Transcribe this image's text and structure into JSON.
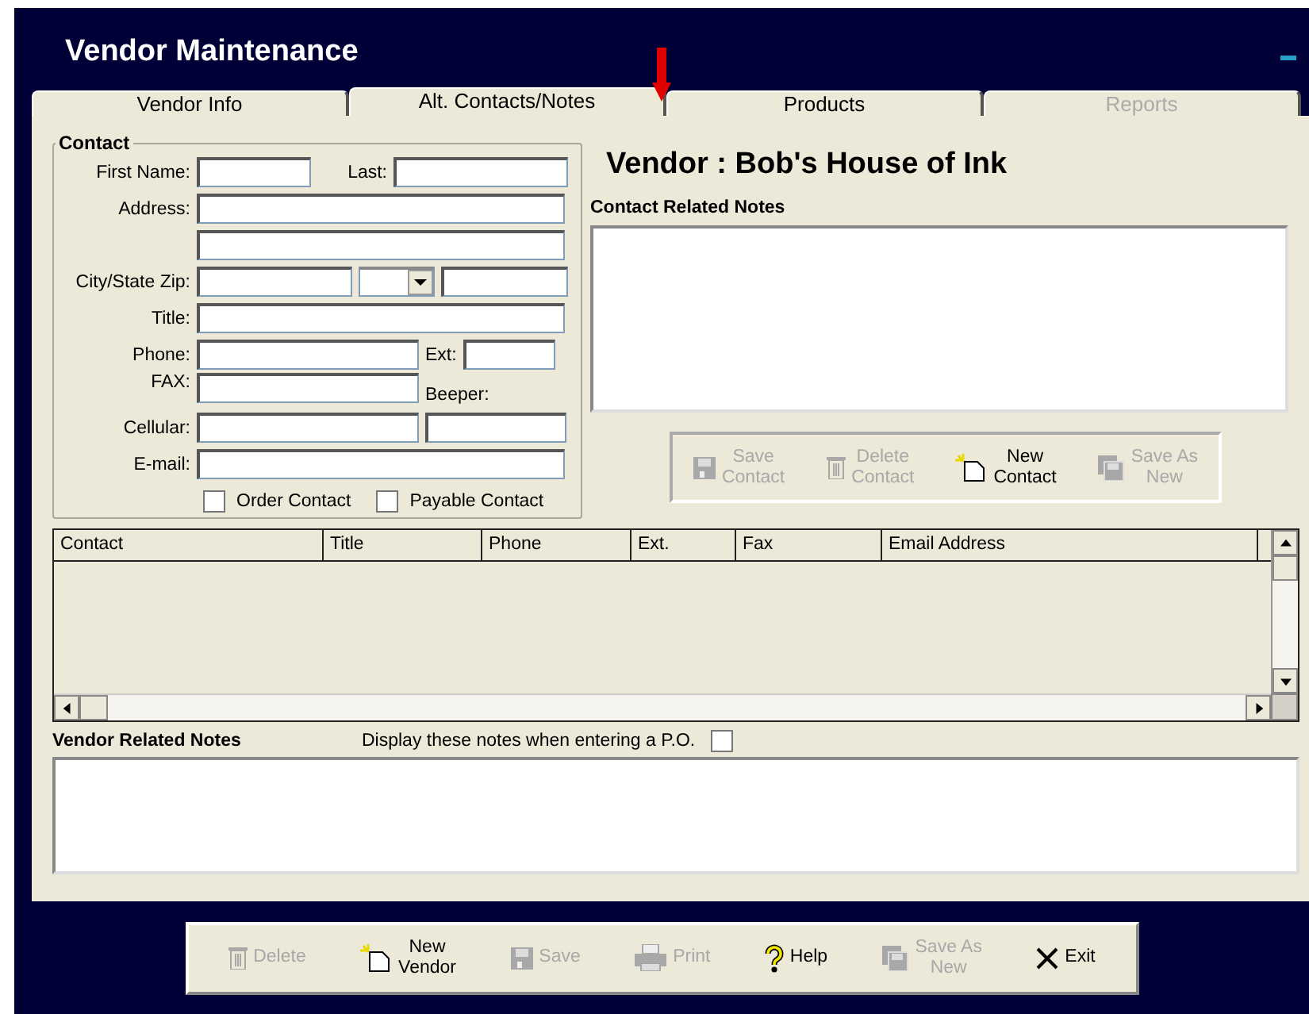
{
  "window": {
    "title": "Vendor Maintenance"
  },
  "tabs": [
    {
      "label": "Vendor Info",
      "selected": false,
      "disabled": false
    },
    {
      "label": "Alt. Contacts/Notes",
      "selected": true,
      "disabled": false
    },
    {
      "label": "Products",
      "selected": false,
      "disabled": false
    },
    {
      "label": "Reports",
      "selected": false,
      "disabled": true
    }
  ],
  "contact": {
    "legend": "Contact",
    "first_name": "First Name:",
    "last": "Last:",
    "address": "Address:",
    "city_state_zip": "City/State Zip:",
    "title": "Title:",
    "phone": "Phone:",
    "ext": "Ext:",
    "fax": "FAX:",
    "beeper": "Beeper:",
    "cellular": "Cellular:",
    "email": "E-mail:",
    "checkboxes": [
      {
        "label": "Order Contact",
        "checked": false
      },
      {
        "label": "Payable Contact",
        "checked": false
      }
    ]
  },
  "vendor_heading": "Vendor :  Bob's House of Ink",
  "contact_notes": {
    "label": "Contact Related Notes"
  },
  "contact_buttons": [
    {
      "kind": "save",
      "lines": [
        "Save",
        "Contact"
      ],
      "disabled": true
    },
    {
      "kind": "delete",
      "lines": [
        "Delete",
        "Contact"
      ],
      "disabled": true
    },
    {
      "kind": "new",
      "lines": [
        "New",
        "Contact"
      ],
      "disabled": false
    },
    {
      "kind": "saveas",
      "lines": [
        "Save As",
        "New"
      ],
      "disabled": true
    }
  ],
  "table": {
    "columns": [
      "Contact",
      "Title",
      "Phone",
      "Ext.",
      "Fax",
      "Email Address"
    ]
  },
  "vendor_notes": {
    "label": "Vendor Related Notes",
    "option": {
      "label": "Display these notes when entering a P.O.",
      "checked": false
    }
  },
  "toolbar": [
    {
      "kind": "delete",
      "lines": [
        "Delete"
      ],
      "disabled": true
    },
    {
      "kind": "new",
      "lines": [
        "New",
        "Vendor"
      ],
      "disabled": false
    },
    {
      "kind": "save",
      "lines": [
        "Save"
      ],
      "disabled": true
    },
    {
      "kind": "print",
      "lines": [
        "Print"
      ],
      "disabled": true
    },
    {
      "kind": "help",
      "lines": [
        "Help"
      ],
      "disabled": false
    },
    {
      "kind": "saveas",
      "lines": [
        "Save As",
        "New"
      ],
      "disabled": true
    },
    {
      "kind": "exit",
      "lines": [
        "Exit"
      ],
      "disabled": false
    }
  ]
}
